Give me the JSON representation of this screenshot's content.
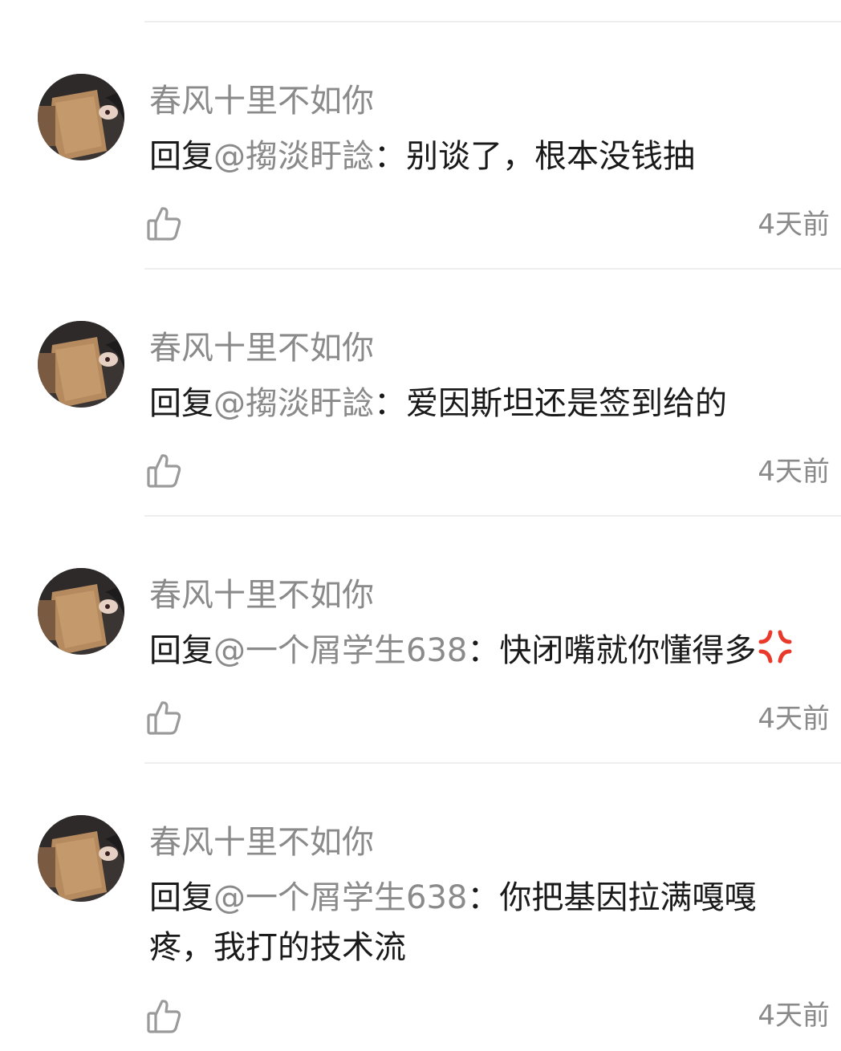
{
  "comments": [
    {
      "username": "春风十里不如你",
      "reply_prefix": "回复",
      "mention": "@搊淡盱諗",
      "separator": "：",
      "content": "别谈了，根本没钱抽",
      "emoji": "",
      "time": "4天前",
      "like_icon": "thumbs-up-outline"
    },
    {
      "username": "春风十里不如你",
      "reply_prefix": "回复",
      "mention": "@搊淡盱諗",
      "separator": "：",
      "content": "爱因斯坦还是签到给的",
      "emoji": "",
      "time": "4天前",
      "like_icon": "thumbs-up-outline"
    },
    {
      "username": "春风十里不如你",
      "reply_prefix": "回复",
      "mention": "@一个屑学生638",
      "separator": "：",
      "content": "快闭嘴就你懂得多",
      "emoji": "anger-symbol",
      "time": "4天前",
      "like_icon": "thumbs-up-outline"
    },
    {
      "username": "春风十里不如你",
      "reply_prefix": "回复",
      "mention": "@一个屑学生638",
      "separator": "：",
      "content": "你把基因拉满嘎嘎疼，我打的技术流",
      "emoji": "",
      "time": "4天前",
      "like_icon": "thumbs-up-outline"
    }
  ],
  "colors": {
    "username": "#8a8a8a",
    "mention": "#8a8a8a",
    "content": "#1a1a1a",
    "timestamp": "#8a8a8a",
    "divider": "#eeeeee",
    "anger_emoji": "#e8392b"
  }
}
